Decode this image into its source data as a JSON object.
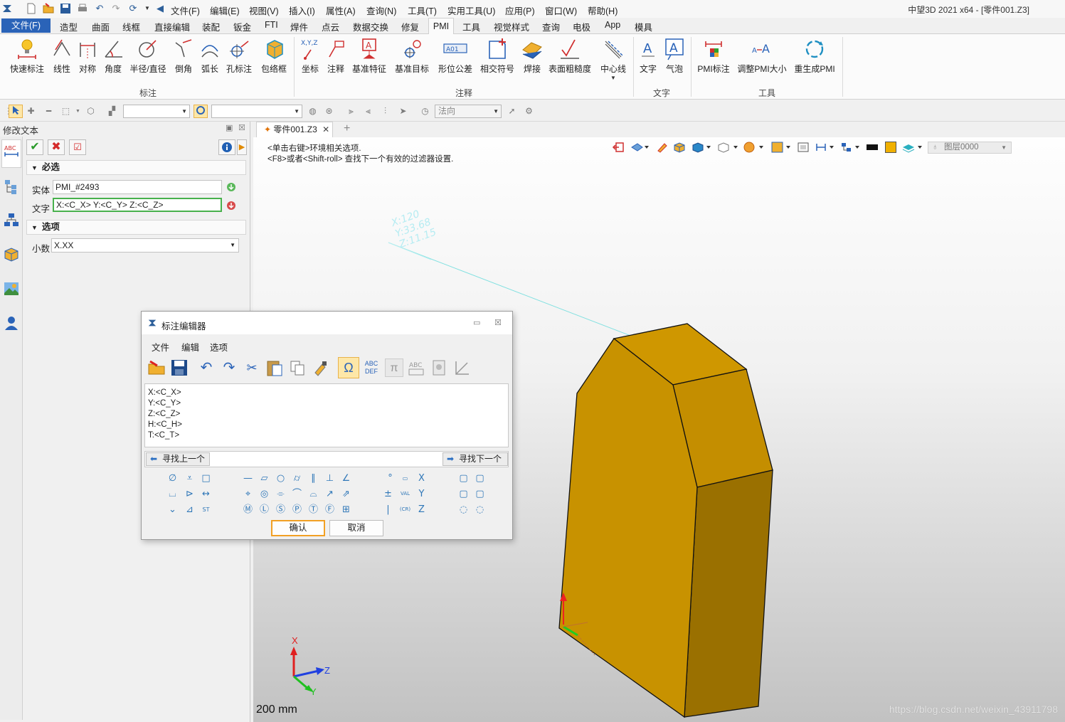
{
  "window": {
    "app_title": "中望3D 2021 x64 - [零件001.Z3]"
  },
  "menubar": [
    "文件(F)",
    "编辑(E)",
    "视图(V)",
    "插入(I)",
    "属性(A)",
    "查询(N)",
    "工具(T)",
    "实用工具(U)",
    "应用(P)",
    "窗口(W)",
    "帮助(H)"
  ],
  "ribbon_tabs": {
    "file": "文件(F)",
    "items": [
      "造型",
      "曲面",
      "线框",
      "直接编辑",
      "装配",
      "钣金",
      "FTI",
      "焊件",
      "点云",
      "数据交换",
      "修复"
    ],
    "active": "PMI",
    "items_after": [
      "工具",
      "视觉样式",
      "查询",
      "电极",
      "App",
      "模具"
    ]
  },
  "ribbon": {
    "groups": {
      "dimension": {
        "label": "标注",
        "buttons": [
          "快速标注",
          "线性",
          "对称",
          "角度",
          "半径/直径",
          "倒角",
          "弧长",
          "孔标注",
          "包络框"
        ]
      },
      "annotation": {
        "label": "注释",
        "buttons": [
          "坐标",
          "注释",
          "基准特征",
          "基准目标",
          "形位公差",
          "相交符号",
          "焊接",
          "表面粗糙度",
          "中心线"
        ]
      },
      "text": {
        "label": "文字",
        "buttons": [
          "文字",
          "气泡"
        ]
      },
      "tools": {
        "label": "工具",
        "buttons": [
          "PMI标注",
          "调整PMI大小",
          "重生成PMI"
        ]
      }
    }
  },
  "toolbar2": {
    "view_direction": "法向"
  },
  "panel": {
    "title": "修改文本",
    "required_section": "必选",
    "entity_label": "实体",
    "entity_value": "PMI_#2493",
    "text_label": "文字",
    "text_value": "X:<C_X> Y:<C_Y> Z:<C_Z>",
    "options_section": "选项",
    "decimal_label": "小数",
    "decimal_value": "X.XX"
  },
  "document": {
    "tab_label": "零件001.Z3"
  },
  "viewport": {
    "hint_line1": "<单击右键>环境相关选项.",
    "hint_line2": "<F8>或者<Shift-roll> 查找下一个有效的过滤器设置.",
    "layer": "图层0000",
    "scale": "200 mm",
    "watermark": "https://blog.csdn.net/weixin_43911798",
    "pmi_label_lines": [
      "X:120",
      "Y:33.68",
      "Z:11.15"
    ],
    "triad_x": "X",
    "triad_y": "Y",
    "triad_z": "Z",
    "part_color": "#c89200"
  },
  "dialog": {
    "title": "标注编辑器",
    "menu": [
      "文件",
      "编辑",
      "选项"
    ],
    "editor_text": "X:<C_X>\nY:<C_Y>\nZ:<C_Z>\nH:<C_H>\nT:<C_T>",
    "find_prev": "寻找上一个",
    "find_next": "寻找下一个",
    "ok": "确认",
    "cancel": "取消",
    "toolbar_labels": {
      "abc_def": "ABC DEF"
    }
  }
}
